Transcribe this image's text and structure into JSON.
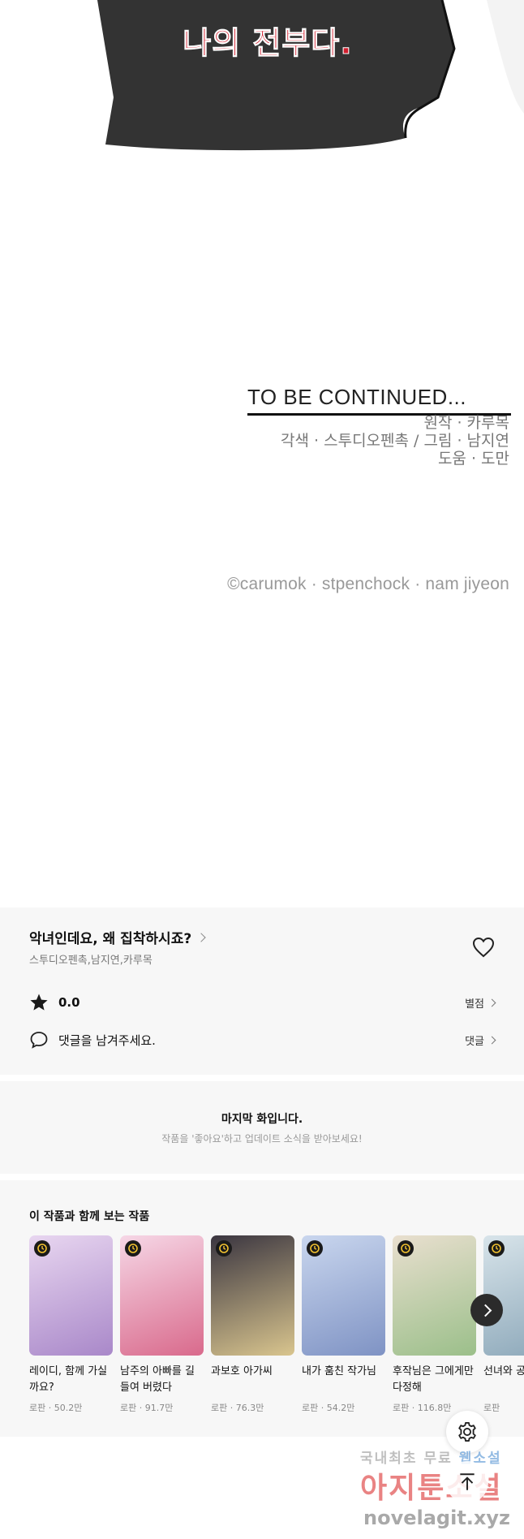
{
  "comic": {
    "bubble_text": "나의 전부다.",
    "tbc_title": "TO BE CONTINUED...",
    "credits": [
      "원작 · 카루목",
      "각색 · 스투디오펜촉 / 그림 · 남지연",
      "도움 · 도만"
    ],
    "copyright": "©carumok · stpenchock · nam jiyeon"
  },
  "info": {
    "series_title": "악녀인데요, 왜 집착하시죠?",
    "authors": "스투디오펜촉,남지연,카루목",
    "rating": "0.0",
    "rate_label": "별점",
    "comment_prompt": "댓글을 남겨주세요.",
    "comment_label": "댓글"
  },
  "last_episode": {
    "title": "마지막 화입니다.",
    "subtitle": "작품을 '좋아요'하고 업데이트 소식을 받아보세요!"
  },
  "recommendations": {
    "title": "이 작품과 함께 보는 작품",
    "items": [
      {
        "title": "레이디, 함께 가실까요?",
        "meta": "로판 · 50.2만",
        "c1": "#e8d6f0",
        "c2": "#a988c9"
      },
      {
        "title": "남주의 아빠를 길들여 버렸다",
        "meta": "로판 · 91.7만",
        "c1": "#f6d7e6",
        "c2": "#d96a8c"
      },
      {
        "title": "과보호 아가씨",
        "meta": "로판 · 76.3만",
        "c1": "#3a3540",
        "c2": "#d9c58e"
      },
      {
        "title": "내가 훔친 작가님",
        "meta": "로판 · 54.2만",
        "c1": "#c9d6ee",
        "c2": "#7f93c4"
      },
      {
        "title": "후작님은 그에게만 다정해",
        "meta": "로판 · 116.8만",
        "c1": "#e9dfcf",
        "c2": "#9bbf8a"
      },
      {
        "title": "선녀와 공작",
        "meta": "로판",
        "c1": "#d8e4ea",
        "c2": "#8aa6b8"
      }
    ]
  },
  "watermark": {
    "line1_a": "국내최초 무료",
    "line1_b": "웹소설",
    "line2": "아지툰소설",
    "line3": "novelagit.xyz"
  }
}
